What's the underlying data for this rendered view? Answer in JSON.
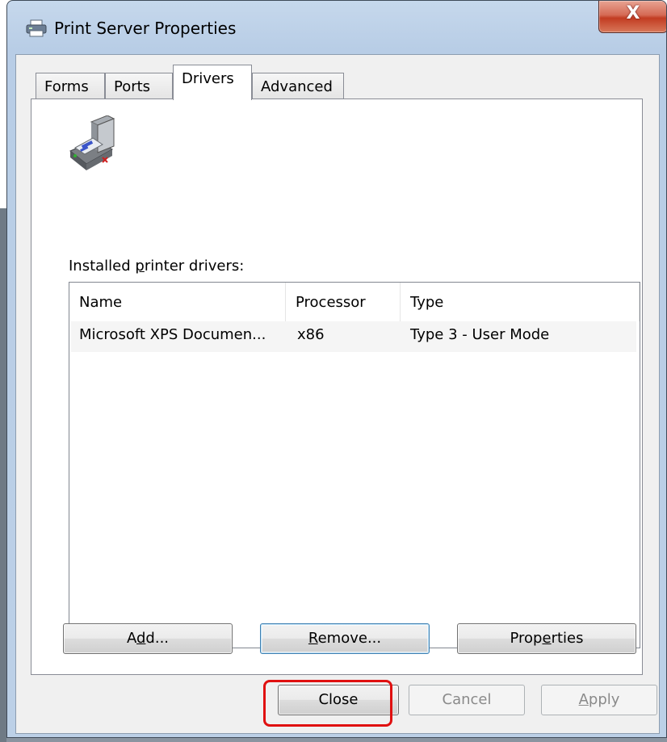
{
  "window": {
    "title": "Print Server Properties",
    "close_glyph": "X",
    "icon": "printer-icon"
  },
  "tabs": [
    {
      "label": "Forms"
    },
    {
      "label": "Ports"
    },
    {
      "label": "Drivers"
    },
    {
      "label": "Advanced"
    }
  ],
  "active_tab": "Drivers",
  "panel": {
    "icon": "printer-driver-icon",
    "label_pre": "Installed ",
    "label_accel": "p",
    "label_post": "rinter drivers:",
    "columns": [
      "Name",
      "Processor",
      "Type"
    ],
    "rows": [
      [
        "Microsoft XPS Documen...",
        "x86",
        "Type 3 - User Mode"
      ]
    ],
    "buttons": {
      "add": {
        "pre": "A",
        "accel": "d",
        "post": "d..."
      },
      "remove": {
        "pre": "",
        "accel": "R",
        "post": "emove..."
      },
      "properties": {
        "pre": "Prop",
        "accel": "e",
        "post": "rties"
      }
    }
  },
  "footer": {
    "close": "Close",
    "cancel": "Cancel",
    "apply": {
      "pre": "",
      "accel": "A",
      "post": "pply"
    }
  },
  "colors": {
    "highlight": "#e01010",
    "title_bar": "#bcd0e7",
    "close_button": "#c23c22"
  }
}
